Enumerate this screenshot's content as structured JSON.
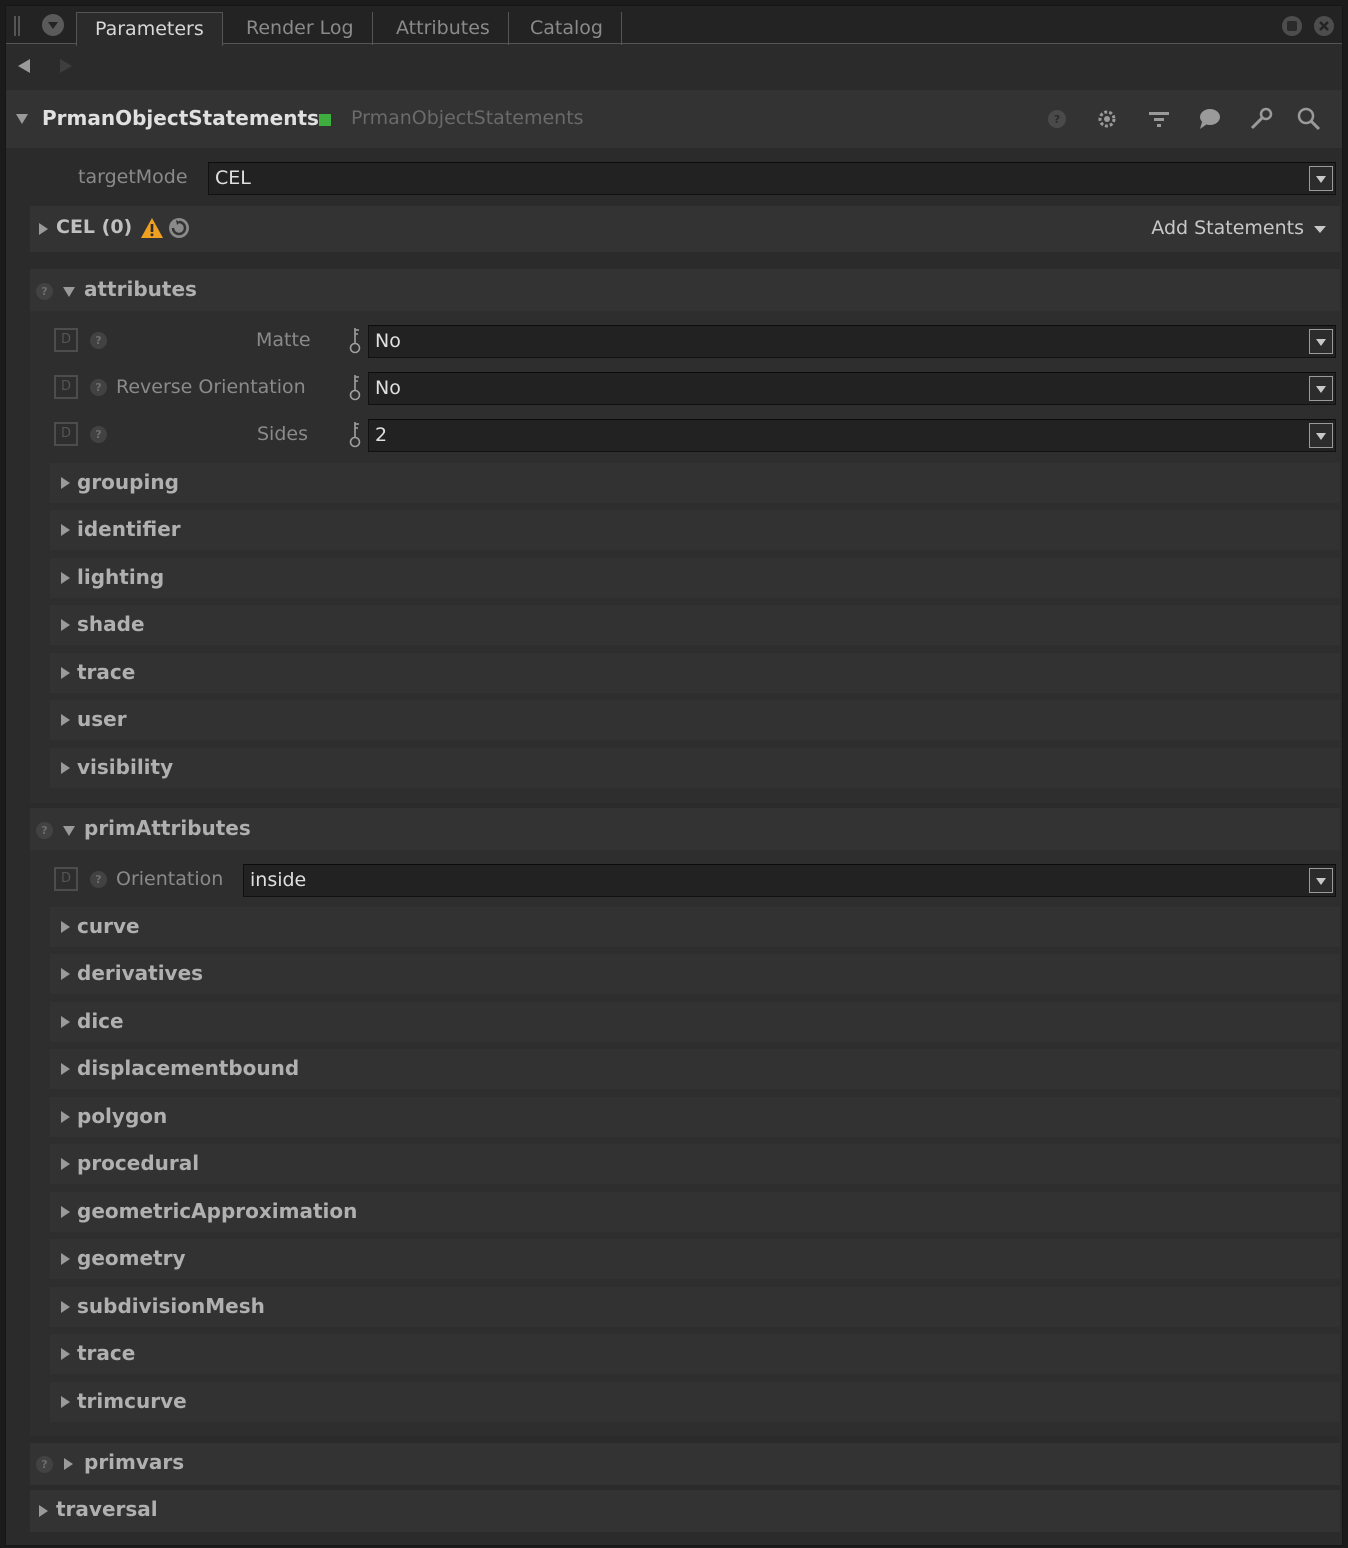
{
  "tabs": [
    "Parameters",
    "Render Log",
    "Attributes",
    "Catalog"
  ],
  "node": {
    "name": "PrmanObjectStatements",
    "type": "PrmanObjectStatements"
  },
  "targetMode": {
    "label": "targetMode",
    "value": "CEL"
  },
  "cel": {
    "label": "CEL (0)",
    "add_statements": "Add Statements"
  },
  "attributes": {
    "label": "attributes",
    "params": [
      {
        "label": "Matte",
        "value": "No"
      },
      {
        "label": "Reverse Orientation",
        "value": "No"
      },
      {
        "label": "Sides",
        "value": "2"
      }
    ],
    "groups": [
      "grouping",
      "identifier",
      "lighting",
      "shade",
      "trace",
      "user",
      "visibility"
    ]
  },
  "primAttributes": {
    "label": "primAttributes",
    "orientation": {
      "label": "Orientation",
      "value": "inside"
    },
    "groups": [
      "curve",
      "derivatives",
      "dice",
      "displacementbound",
      "polygon",
      "procedural",
      "geometricApproximation",
      "geometry",
      "subdivisionMesh",
      "trace",
      "trimcurve"
    ]
  },
  "primvars": {
    "label": "primvars"
  },
  "traversal": {
    "label": "traversal"
  },
  "icons": {
    "d_box": "D",
    "help": "?"
  },
  "colors": {
    "accent_green": "#3fae3f",
    "warning": "#f0a020"
  }
}
